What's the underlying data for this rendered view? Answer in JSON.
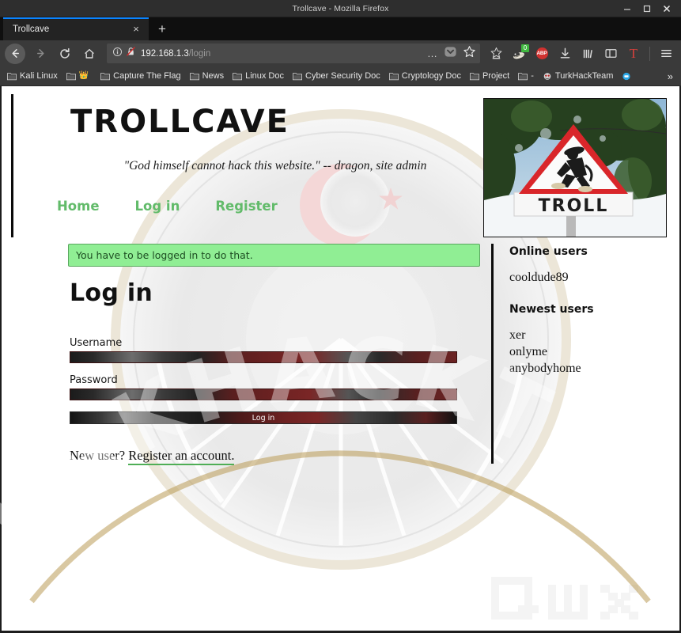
{
  "window": {
    "title": "Trollcave - Mozilla Firefox",
    "controls": {
      "minimize": "minimize-button",
      "maximize": "maximize-button",
      "close": "close-button"
    }
  },
  "browser": {
    "tab": {
      "title": "Trollcave",
      "close_label": "×"
    },
    "new_tab_label": "+",
    "nav": {
      "back": "back-button",
      "forward": "forward-button",
      "reload": "reload-button",
      "home": "home-button"
    },
    "url": {
      "host": "192.168.1.3",
      "path": "/login",
      "full": "192.168.1.3/login",
      "identity_icon": "info-icon",
      "insecure_login_icon": "crossed-out-lock-icon",
      "page_actions_label": "…"
    },
    "toolbar_icons": [
      {
        "name": "pocket-icon",
        "label": ""
      },
      {
        "name": "privacy-badger-icon",
        "label": "",
        "badge": "0"
      },
      {
        "name": "adblock-plus-icon",
        "label": "ABP"
      },
      {
        "name": "downloads-icon",
        "label": ""
      },
      {
        "name": "library-icon",
        "label": ""
      },
      {
        "name": "sidebar-icon",
        "label": ""
      },
      {
        "name": "tampermonkey-icon",
        "label": "T"
      },
      {
        "name": "app-menu-icon",
        "label": ""
      }
    ],
    "bookmarks": [
      {
        "label": "Kali Linux",
        "icon": "folder-icon"
      },
      {
        "label": "",
        "icon": "crown-icon"
      },
      {
        "label": "Capture The Flag",
        "icon": "folder-icon"
      },
      {
        "label": "News",
        "icon": "folder-icon"
      },
      {
        "label": "Linux Doc",
        "icon": "folder-icon"
      },
      {
        "label": "Cyber Security Doc",
        "icon": "folder-icon"
      },
      {
        "label": "Cryptology Doc",
        "icon": "folder-icon"
      },
      {
        "label": "Project",
        "icon": "folder-icon"
      },
      {
        "label": "-",
        "icon": "folder-icon"
      },
      {
        "label": "TurkHackTeam",
        "icon": "site-icon"
      },
      {
        "label": "",
        "icon": "blue-dot-icon"
      }
    ],
    "bookmarks_overflow_label": "»"
  },
  "site": {
    "brand": "TROLLCAVE",
    "tagline": "\"God himself cannot hack this website.\" -- dragon, site admin",
    "nav": [
      {
        "label": "Home"
      },
      {
        "label": "Log in"
      },
      {
        "label": "Register"
      }
    ],
    "header_image_alt": "TROLL warning road sign photo",
    "header_image_sign_text": "TROLL"
  },
  "main": {
    "flash_message": "You have to be logged in to do that.",
    "page_title": "Log in",
    "form": {
      "username_label": "Username",
      "username_value": "",
      "password_label": "Password",
      "password_value": "",
      "submit_label": "Log in"
    },
    "new_user_prefix": "New user?",
    "register_link": "Register an account."
  },
  "sidebar": {
    "online_heading": "Online users",
    "online_users": [
      "cooldude89"
    ],
    "newest_heading": "Newest users",
    "newest_users": [
      "xer",
      "onlyme",
      "anybodyhome"
    ]
  },
  "watermarks": {
    "text": "TURKHACKTEAM",
    "corner_mark": "Qw"
  },
  "colors": {
    "accent_green": "#62bb6a",
    "flash_bg": "#90ee94",
    "flash_border": "#5aa85f",
    "tab_accent": "#0a84ff",
    "chrome_bg": "#3a3a3a",
    "titlebar_bg": "#2e2e2e"
  }
}
